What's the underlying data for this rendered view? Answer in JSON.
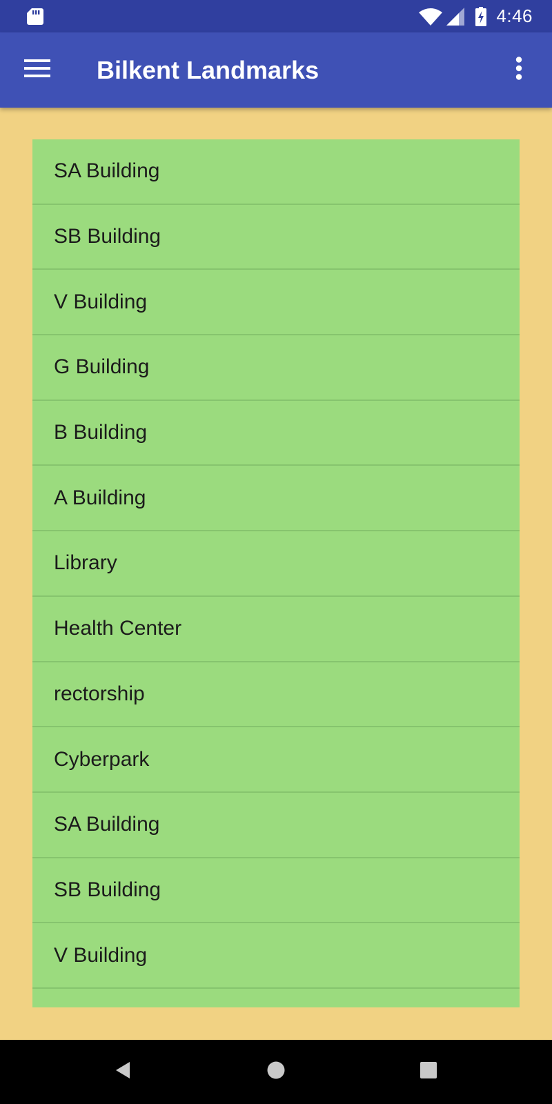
{
  "status_bar": {
    "time": "4:46",
    "icons": [
      "sd-card-icon",
      "wifi-icon",
      "signal-icon",
      "battery-charging-icon"
    ]
  },
  "app_bar": {
    "title": "Bilkent Landmarks",
    "menu_icon": "hamburger-menu-icon",
    "overflow_icon": "more-vert-icon"
  },
  "landmarks": [
    "SA Building",
    "SB Building",
    "V Building",
    "G Building",
    "B Building",
    "A Building",
    "Library",
    "Health Center",
    "rectorship",
    "Cyberpark",
    "SA Building",
    "SB Building",
    "V Building"
  ],
  "nav_bar": {
    "buttons": [
      "back-icon",
      "home-icon",
      "recents-icon"
    ]
  },
  "colors": {
    "status_bar": "#303F9F",
    "app_bar": "#3F51B5",
    "page_background": "#F1D283",
    "list_background": "#9BDB7E",
    "divider": "#86C46E",
    "nav_bar": "#000000"
  }
}
